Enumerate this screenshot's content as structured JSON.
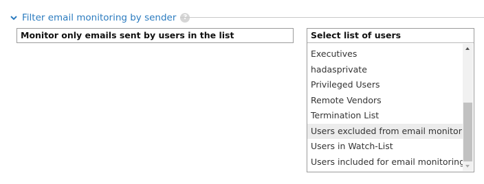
{
  "section": {
    "title": "Filter email monitoring by sender",
    "help": "?",
    "expand_icon": "chevron-down-icon",
    "accent_color": "#2b7bbf"
  },
  "mode": {
    "value": "Monitor only emails sent by users in the list"
  },
  "user_list": {
    "header": "Select list of users",
    "items": [
      {
        "label": "Executives",
        "selected": false
      },
      {
        "label": "hadasprivate",
        "selected": false
      },
      {
        "label": "Privileged Users",
        "selected": false
      },
      {
        "label": "Remote Vendors",
        "selected": false
      },
      {
        "label": "Termination List",
        "selected": false
      },
      {
        "label": "Users excluded from email monitoring",
        "selected": true
      },
      {
        "label": "Users in Watch-List",
        "selected": false
      },
      {
        "label": "Users included for email monitoring",
        "selected": false
      }
    ]
  }
}
